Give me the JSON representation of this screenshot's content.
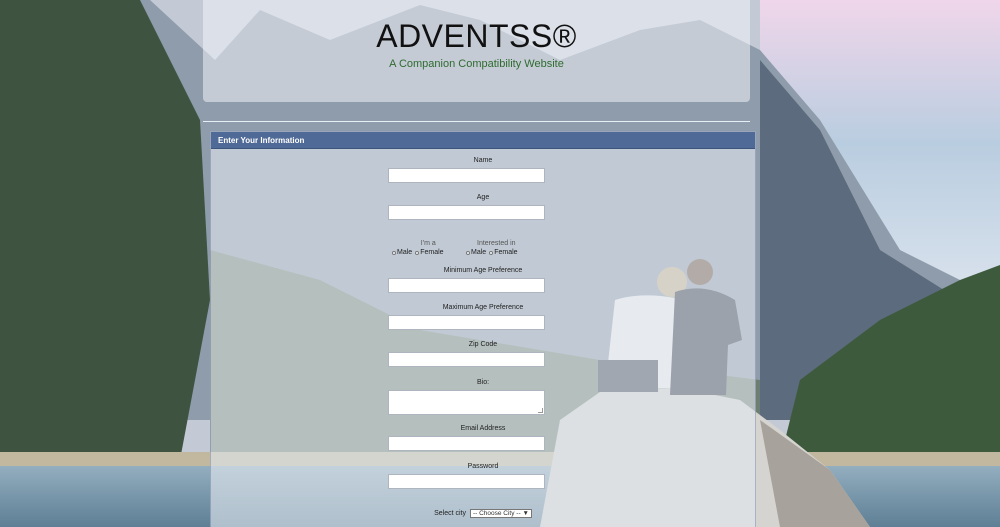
{
  "header": {
    "title": "ADVENTSS®",
    "tagline": "A Companion Compatibility Website"
  },
  "panel": {
    "heading": "Enter Your Information"
  },
  "form": {
    "name_label": "Name",
    "age_label": "Age",
    "im_a_label": "I'm a",
    "interested_in_label": "Interested in",
    "male_label": "Male",
    "female_label": "Female",
    "min_age_label": "Minimum Age Preference",
    "max_age_label": "Maximum Age Preference",
    "zip_label": "Zip Code",
    "bio_label": "Bio:",
    "email_label": "Email Address",
    "password_label": "Password",
    "select_city_label": "Select city",
    "city_select_value": "-- Choose City --"
  }
}
